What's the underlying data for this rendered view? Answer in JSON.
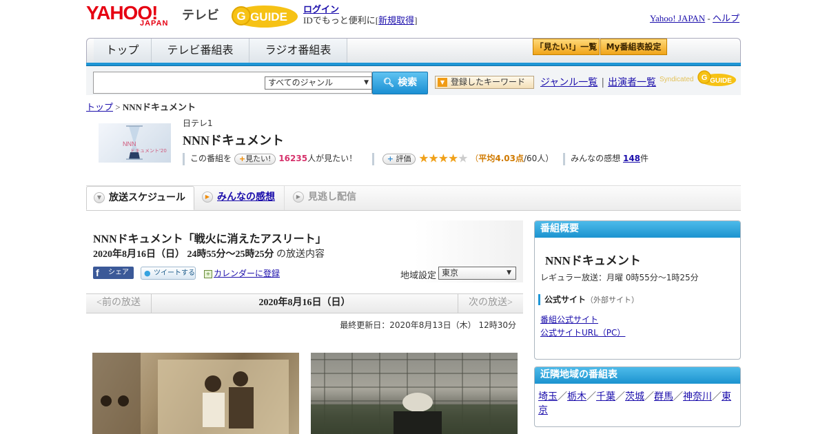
{
  "header": {
    "logo_yahoo": "YAHOO!",
    "logo_japan": "JAPAN",
    "logo_tv": "テレビ",
    "logo_gguide": "GUIDE",
    "login_label": "ログイン",
    "login_promo_prefix": "IDでもっと便利に[",
    "register_label": "新規取得",
    "login_promo_suffix": "]",
    "yahoo_japan_link": "Yahoo! JAPAN",
    "separator": "-",
    "help_link": "ヘルプ"
  },
  "mainnav": {
    "tabs": [
      "トップ",
      "テレビ番組表",
      "ラジオ番組表"
    ],
    "mitai_list": "「見たい!」一覧",
    "my_schedule": "My番組表設定"
  },
  "search": {
    "input_value": "",
    "genre_selected": "すべてのジャンル",
    "button_label": "検索",
    "keyword_button": "登録したキーワード",
    "genre_list_link": "ジャンル一覧",
    "separator": "|",
    "performer_list_link": "出演者一覧",
    "syndicated": "Syndicated",
    "syndicated_brand": "GUIDE"
  },
  "breadcrumb": {
    "home": "トップ",
    "separator": ">",
    "current": "NNNドキュメント"
  },
  "program": {
    "channel": "日テレ1",
    "title": "NNNドキュメント",
    "thumb_text1": "NNN",
    "thumb_text2": "ドキュメント'20",
    "watch_prefix": "この番組を",
    "mitai_button": "見たい!",
    "watch_count": "16235",
    "watch_suffix": "人が見たい！",
    "rate_button": "評価",
    "rating_stars": 4,
    "rating_max": 5,
    "avg_prefix": "（",
    "avg_label": "平均4.03点",
    "avg_suffix": "/60人）",
    "review_prefix": "みんなの感想",
    "review_count": "148",
    "review_suffix": "件"
  },
  "subtabs": {
    "schedule": "放送スケジュール",
    "reviews": "みんなの感想",
    "missed": "見逃し配信"
  },
  "episode": {
    "title": "NNNドキュメント「戦火に消えたアスリート」",
    "date_time": "2020年8月16日（日） 24時55分～25時25分",
    "date_suffix": "の放送内容",
    "share_label": "シェア",
    "tweet_label": "ツイートする",
    "calendar_label": "カレンダーに登録",
    "region_label": "地域設定",
    "region_value": "東京",
    "prev": "<前の放送",
    "current_date": "2020年8月16日（日）",
    "next": "次の放送>",
    "last_updated": "最終更新日：2020年8月13日（木） 12時30分"
  },
  "sidebar": {
    "overview_head": "番組概要",
    "overview_title": "NNNドキュメント",
    "regular": "レギュラー放送：月曜 0時55分～1時25分",
    "official_label": "公式サイト",
    "official_note": "（外部サイト）",
    "link1": "番組公式サイト",
    "link2": "公式サイトURL（PC）",
    "nearby_head": "近隣地域の番組表",
    "nearby_regions": [
      "埼玉",
      "栃木",
      "千葉",
      "茨城",
      "群馬",
      "神奈川",
      "東京"
    ],
    "nearby_sep": "／"
  },
  "colors": {
    "accent_blue": "#1e96d6",
    "yahoo_red": "#e60012",
    "star_orange": "#f0a11a",
    "count_pink": "#d6336c"
  }
}
